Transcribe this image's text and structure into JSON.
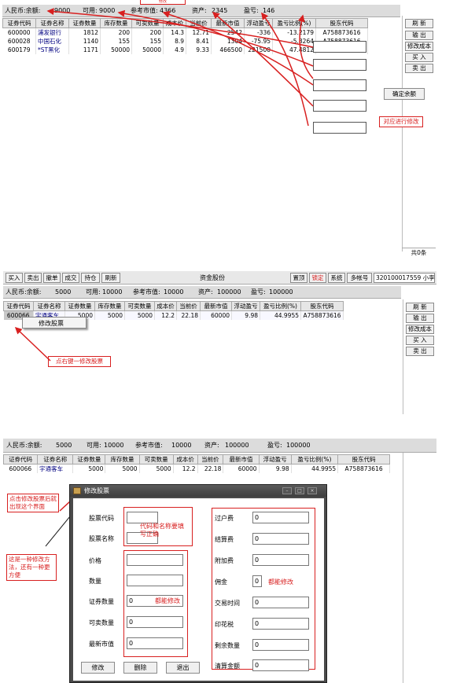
{
  "panel1": {
    "summary": {
      "currency_label": "人民币:余额:",
      "balance": "9000",
      "available_label": "可用:",
      "available": "9000",
      "ref_market_label": "参考市值:",
      "ref_market": "4366",
      "assets_label": "资产:",
      "assets": "2345",
      "pnl_label": "盈亏:",
      "pnl": "146",
      "cut_text": "修改"
    },
    "columns": [
      "证券代码",
      "证券名称",
      "证券数量",
      "库存数量",
      "可卖数量",
      "成本价",
      "当前价",
      "最新市值",
      "浮动盈亏",
      "盈亏比例(%)",
      "股东代码"
    ],
    "rows": [
      [
        "600000",
        "浦发银行",
        "1812",
        "200",
        "200",
        "14.3",
        "12.71",
        "2542",
        "-336",
        "-13.2179",
        "A758873616"
      ],
      [
        "600028",
        "中国石化",
        "1140",
        "155",
        "155",
        "8.9",
        "8.41",
        "1304",
        "-75.95",
        "-5.8264",
        "A758873616"
      ],
      [
        "600179",
        "*ST黑化",
        "1171",
        "50000",
        "50000",
        "4.9",
        "9.33",
        "466500",
        "221500",
        "47.4812",
        "A758873616"
      ]
    ],
    "side_buttons": [
      "刷 新",
      "输 出",
      "修改成本",
      "买 入",
      "卖 出"
    ],
    "confirm_button": "确定余额",
    "annotation": "对应进行修改",
    "row_count": "共0条"
  },
  "panel2": {
    "toolbar": [
      "买入",
      "卖出",
      "撤单",
      "成交",
      "持仓",
      "刷新"
    ],
    "title": "资金股份",
    "right_buttons": [
      "置顶",
      "锁定",
      "系统",
      "多帐号"
    ],
    "account": "320100017559 小李",
    "summary": {
      "currency_label": "人民币:余额:",
      "balance": "5000",
      "available_label": "可用:",
      "available": "10000",
      "ref_market_label": "参考市值:",
      "ref_market": "10000",
      "assets_label": "资产:",
      "assets": "100000",
      "pnl_label": "盈亏:",
      "pnl": "100000"
    },
    "columns": [
      "证券代码",
      "证券名称",
      "证券数量",
      "库存数量",
      "可卖数量",
      "成本价",
      "当前价",
      "最新市值",
      "浮动盈亏",
      "盈亏比例(%)",
      "股东代码"
    ],
    "row": [
      "600066",
      "宇通客车",
      "5000",
      "5000",
      "5000",
      "12.2",
      "22.18",
      "60000",
      "9.98",
      "44.9955",
      "A758873616"
    ],
    "context_menu_item": "修改股票",
    "side_buttons": [
      "刷 新",
      "输 出",
      "修改成本",
      "买 入",
      "卖 出"
    ],
    "annotation": "点右键一修改股票"
  },
  "panel3": {
    "summary": {
      "currency_label": "人民币:余额:",
      "balance": "5000",
      "available_label": "可用:",
      "available": "10000",
      "ref_market_label": "参考市值:",
      "ref_market": "10000",
      "assets_label": "资产:",
      "assets": "100000",
      "pnl_label": "盈亏:",
      "pnl": "100000"
    },
    "columns": [
      "证券代码",
      "证券名称",
      "证券数量",
      "库存数量",
      "可卖数量",
      "成本价",
      "当前价",
      "最新市值",
      "浮动盈亏",
      "盈亏比例(%)",
      "股东代码"
    ],
    "row": [
      "600066",
      "宇通客车",
      "5000",
      "5000",
      "5000",
      "12.2",
      "22.18",
      "60000",
      "9.98",
      "44.9955",
      "A758873616"
    ],
    "annotation_top": "点击修改股票后就出现这个界面",
    "annotation_left": "这是一种修改方法，还有一种更方便",
    "dialog": {
      "title": "修改股票",
      "left_fields": [
        {
          "label": "股票代码",
          "value": ""
        },
        {
          "label": "股票名称",
          "value": ""
        },
        {
          "label": "价格",
          "value": ""
        },
        {
          "label": "数量",
          "value": ""
        },
        {
          "label": "证券数量",
          "value": "0"
        },
        {
          "label": "可卖数量",
          "value": "0"
        },
        {
          "label": "最新市值",
          "value": "0"
        }
      ],
      "right_fields": [
        {
          "label": "过户费",
          "value": "0"
        },
        {
          "label": "结算费",
          "value": "0"
        },
        {
          "label": "附加费",
          "value": "0"
        },
        {
          "label": "佣金",
          "value": "0"
        },
        {
          "label": "交易时间",
          "value": "0"
        },
        {
          "label": "印花税",
          "value": "0"
        },
        {
          "label": "剩余数量",
          "value": "0"
        },
        {
          "label": "清算金额",
          "value": "0"
        }
      ],
      "note_code": "代码和名称要填写正确",
      "note_modify_left": "都能修改",
      "note_modify_right": "都能修改",
      "buttons": [
        "修改",
        "删除",
        "退出"
      ]
    }
  }
}
